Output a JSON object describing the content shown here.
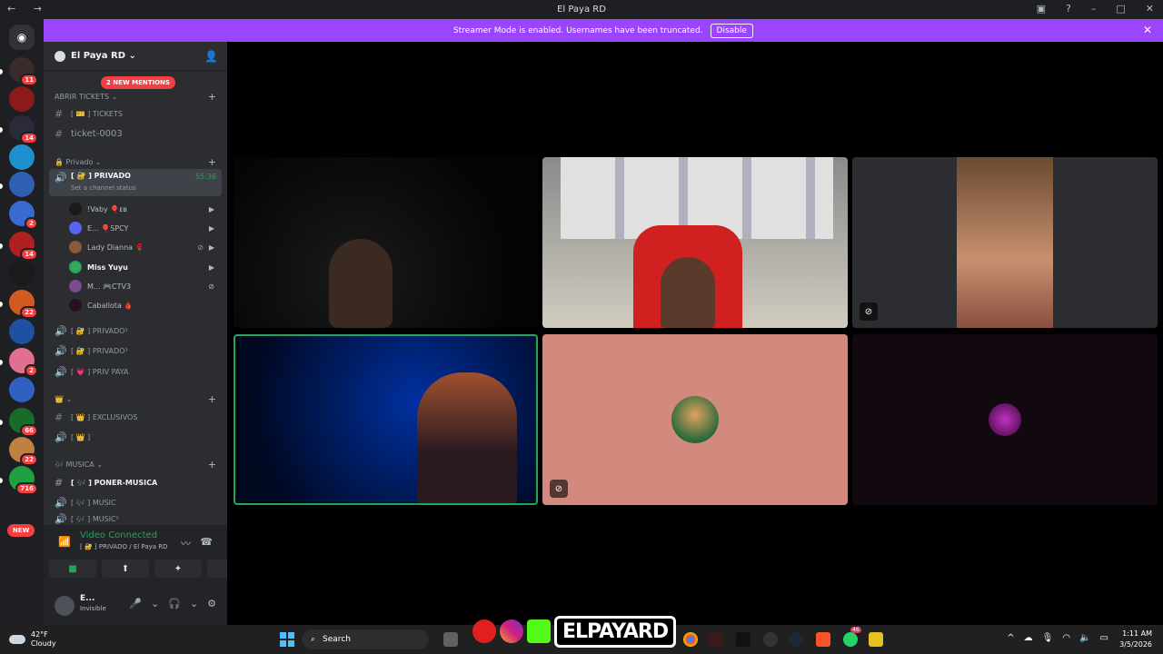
{
  "window": {
    "title": "El Paya RD"
  },
  "banner": {
    "text": "Streamer Mode is enabled. Usernames have been truncated.",
    "disable_label": "Disable"
  },
  "servers": {
    "badges": [
      "11",
      "14",
      "2",
      "14",
      "22",
      "2",
      "66",
      "22",
      "716"
    ],
    "new_label": "NEW"
  },
  "guild": {
    "name": "El Paya RD",
    "mentions": "2 NEW MENTIONS"
  },
  "channels": {
    "cat_tickets": "ABRIR TICKETS",
    "ch_tickets": "[ 🎫 ] TICKETS",
    "ch_ticket_0003": "ticket-0003",
    "cat_privado": "Privado",
    "active_channel": "[ 🔐 ] PRIVADO",
    "active_timer": "55:36",
    "active_status": "Set a channel status",
    "users": [
      {
        "name": "!Vaby 🎈ᴇʙ",
        "color": "#1a1a1a"
      },
      {
        "name": "E... 🎈SPCY",
        "color": "#5865f2"
      },
      {
        "name": "Lady Dianna 🌹",
        "color": "#8b5a3c"
      },
      {
        "name": "Miss Yuyu",
        "color": "#3ba55c"
      },
      {
        "name": "M... 🎮CTV3",
        "color": "#7a4a8a"
      },
      {
        "name": "Caballota 🩸",
        "color": "#2a1020"
      }
    ],
    "ch_privado2": "[ 🔐 ] PRIVADO²",
    "ch_privado3": "[ 🔐 ] PRIVADO³",
    "ch_priv_paya": "[ 💗 ] PRIV PAYA",
    "ch_exclusivos": "[ 👑 ] EXCLUSIVOS",
    "ch_crown": "[ 👑 ]",
    "cat_musica": "MUSICA",
    "ch_poner_musica": "[ 🎶 ] PONER-MUSICA",
    "ch_music": "[ 🎶 ] MUSIC",
    "ch_music2": "[ 🎶 ] MUSIC²"
  },
  "voice": {
    "connected": "Video Connected",
    "path": "[ 🔐 ] PRIVADO / El Paya RD"
  },
  "user": {
    "name": "E...",
    "status": "Invisible"
  },
  "taskbar": {
    "temp": "42°F",
    "weather": "Cloudy",
    "search": "Search",
    "time": "1:11 AM",
    "date": "3/5/2026",
    "whatsapp_badge": "46"
  },
  "overlay": {
    "logo_text": "ELPAYARD"
  },
  "colors": {
    "accent": "#9b45ff",
    "green": "#23a55a",
    "red": "#f23f42"
  }
}
